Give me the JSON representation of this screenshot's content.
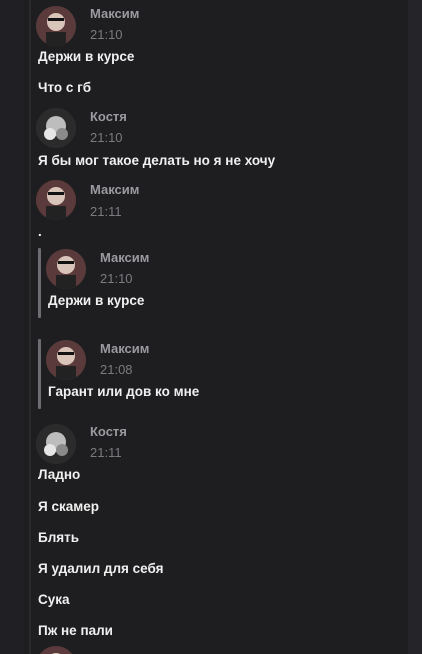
{
  "users": {
    "maxim": "Максим",
    "kostya": "Костя"
  },
  "messages": [
    {
      "name": "Максим",
      "time": "21:10",
      "lines": [
        "Держи в курсе",
        "Что с гб"
      ]
    },
    {
      "name": "Костя",
      "time": "21:10",
      "lines": [
        "Я бы мог такое делать но я не хочу"
      ]
    },
    {
      "name": "Максим",
      "time": "21:11",
      "lines": [
        "."
      ]
    },
    {
      "name": "Костя",
      "time": "21:11",
      "lines": [
        "Ладно",
        "Я скамер",
        "Блять",
        "Я удалил для себя",
        "Сука",
        "Пж не пали"
      ]
    }
  ],
  "quotes": [
    {
      "name": "Максим",
      "time": "21:10",
      "text": "Держи в курсе"
    },
    {
      "name": "Максим",
      "time": "21:08",
      "text": "Гарант или дов ко мне"
    }
  ],
  "icons": {
    "avatar_maxim": "avatar-maxim",
    "avatar_kostya": "avatar-kostya"
  }
}
